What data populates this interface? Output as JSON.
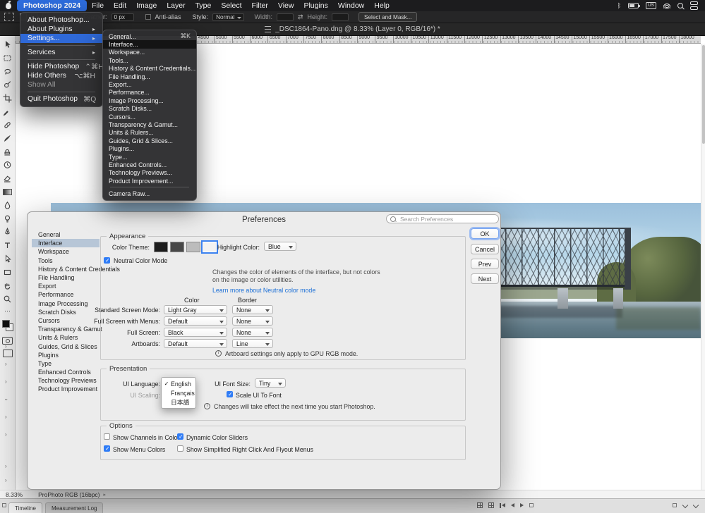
{
  "menubar": {
    "app_name": "Photoshop 2024",
    "menus": [
      "File",
      "Edit",
      "Image",
      "Layer",
      "Type",
      "Select",
      "Filter",
      "View",
      "Plugins",
      "Window",
      "Help"
    ],
    "keyboard_layout": "US"
  },
  "app_menu": {
    "items": [
      {
        "label": "About Photoshop..."
      },
      {
        "label": "About Plugins",
        "arrow": "▸"
      },
      {
        "label": "Settings...",
        "arrow": "▸"
      },
      {
        "label": "Services",
        "arrow": "▸"
      },
      {
        "label": "Hide Photoshop",
        "shortcut": "⌃⌘H"
      },
      {
        "label": "Hide Others",
        "shortcut": "⌥⌘H"
      },
      {
        "label": "Show All"
      },
      {
        "label": "Quit Photoshop",
        "shortcut": "⌘Q"
      }
    ]
  },
  "settings_menu": {
    "items": [
      {
        "label": "General...",
        "shortcut": "⌘K"
      },
      {
        "label": "Interface..."
      },
      {
        "label": "Workspace..."
      },
      {
        "label": "Tools..."
      },
      {
        "label": "History & Content Credentials..."
      },
      {
        "label": "File Handling..."
      },
      {
        "label": "Export..."
      },
      {
        "label": "Performance..."
      },
      {
        "label": "Image Processing..."
      },
      {
        "label": "Scratch Disks..."
      },
      {
        "label": "Cursors..."
      },
      {
        "label": "Transparency & Gamut..."
      },
      {
        "label": "Units & Rulers..."
      },
      {
        "label": "Guides, Grid & Slices..."
      },
      {
        "label": "Plugins..."
      },
      {
        "label": "Type..."
      },
      {
        "label": "Enhanced Controls..."
      },
      {
        "label": "Technology Previews..."
      },
      {
        "label": "Product Improvement..."
      },
      {
        "label": "Camera Raw..."
      }
    ]
  },
  "options_bar": {
    "feather_label": "Feather:",
    "feather_value": "0 px",
    "antialias_label": "Anti-alias",
    "style_label": "Style:",
    "style_value": "Normal",
    "width_label": "Width:",
    "height_label": "Height:",
    "swap_icon": "⇄",
    "select_mask_label": "Select and Mask..."
  },
  "document_tab": {
    "title": "_DSC1864-Pano.dng @ 8.33% (Layer 0, RGB/16*) *"
  },
  "ruler": {
    "labels": [
      "4500",
      "5000",
      "5500",
      "6000",
      "6500",
      "7000",
      "7500",
      "8000",
      "8500",
      "9000",
      "9500",
      "10000",
      "10500",
      "11000",
      "11500",
      "12000",
      "12500",
      "13000",
      "13500",
      "14000",
      "14500",
      "15000",
      "15500",
      "16000",
      "16500",
      "17000",
      "17500",
      "18000"
    ]
  },
  "preferences": {
    "title": "Preferences",
    "search_placeholder": "Search Preferences",
    "sidebar": [
      "General",
      "Interface",
      "Workspace",
      "Tools",
      "History & Content Credentials",
      "File Handling",
      "Export",
      "Performance",
      "Image Processing",
      "Scratch Disks",
      "Cursors",
      "Transparency & Gamut",
      "Units & Rulers",
      "Guides, Grid & Slices",
      "Plugins",
      "Type",
      "Enhanced Controls",
      "Technology Previews",
      "Product Improvement"
    ],
    "appearance": {
      "legend": "Appearance",
      "color_theme_label": "Color Theme:",
      "color_theme_swatches": [
        "#1d1d1d",
        "#484848",
        "#bcbcbc",
        "#f2f2f2"
      ],
      "selected_swatch_index": 3,
      "highlight_color_label": "Highlight Color:",
      "highlight_color_value": "Blue",
      "neutral_color_mode_label": "Neutral Color Mode",
      "neutral_color_mode_checked": true,
      "description": "Changes the color of elements of the interface, but not colors on the image or color utilities.",
      "learn_more": "Learn more about Neutral color mode",
      "column_color": "Color",
      "column_border": "Border",
      "rows": [
        {
          "label": "Standard Screen Mode:",
          "color": "Light Gray",
          "border": "None"
        },
        {
          "label": "Full Screen with Menus:",
          "color": "Default",
          "border": "None"
        },
        {
          "label": "Full Screen:",
          "color": "Black",
          "border": "None"
        },
        {
          "label": "Artboards:",
          "color": "Default",
          "border": "Line"
        }
      ],
      "artboard_note": "Artboard settings only apply to GPU RGB mode."
    },
    "presentation": {
      "legend": "Presentation",
      "ui_language_label": "UI Language:",
      "language_options": [
        "English",
        "Français",
        "日本語"
      ],
      "selected_language": "English",
      "ui_font_size_label": "UI Font Size:",
      "ui_font_size_value": "Tiny",
      "scale_ui_label": "Scale UI To Font",
      "scale_ui_checked": true,
      "ui_scaling_label": "UI Scaling:",
      "note": "Changes will take effect the next time you start Photoshop."
    },
    "options": {
      "legend": "Options",
      "checkboxes": [
        {
          "label": "Show Channels in Color",
          "checked": false
        },
        {
          "label": "Dynamic Color Sliders",
          "checked": true
        },
        {
          "label": "Show Menu Colors",
          "checked": true
        },
        {
          "label": "Show Simplified Right Click And Flyout Menus",
          "checked": false
        }
      ]
    },
    "buttons": {
      "ok": "OK",
      "cancel": "Cancel",
      "prev": "Prev",
      "next": "Next"
    }
  },
  "status_bar": {
    "zoom": "8.33%",
    "profile": "ProPhoto RGB (16bpc)"
  },
  "bottom_panels": {
    "tabs": [
      "Timeline",
      "Measurement Log"
    ]
  }
}
